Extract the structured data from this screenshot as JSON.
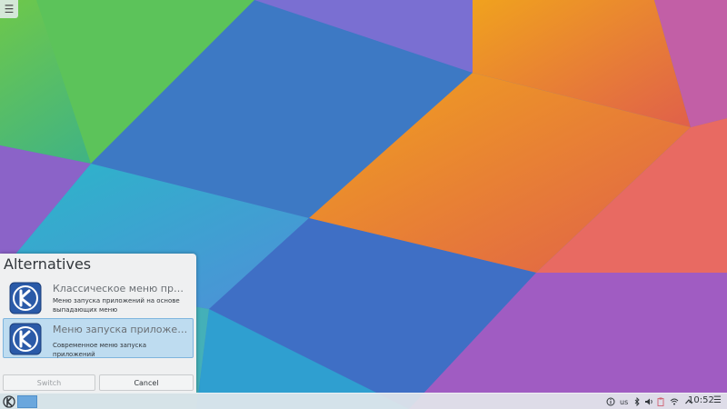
{
  "desktop": {
    "toolbox_icon": "hamburger-icon"
  },
  "dialog": {
    "title": "Alternatives",
    "items": [
      {
        "name": "Классическое меню прилож...",
        "description_lines": [
          "Меню запуска приложений на основе",
          "выпадающих меню"
        ],
        "icon": "kde-logo-icon",
        "selected": false
      },
      {
        "name": "Меню запуска приложений",
        "description_lines": [
          "Современное меню запуска приложений"
        ],
        "icon": "kde-logo-icon",
        "selected": true
      }
    ],
    "switch_label": "Switch",
    "cancel_label": "Cancel"
  },
  "panel": {
    "keyboard_layout": "us",
    "clock": "10:52",
    "tray_icons": [
      "info-icon",
      "bluetooth-icon",
      "volume-icon",
      "clipboard-icon",
      "network-icon",
      "show-hidden-arrow-icon"
    ],
    "menu_icon": "hamburger-icon"
  },
  "colors": {
    "selection_bg": "#bedcf0",
    "selection_border": "#7fb5de",
    "dialog_bg": "#eff0f1"
  }
}
